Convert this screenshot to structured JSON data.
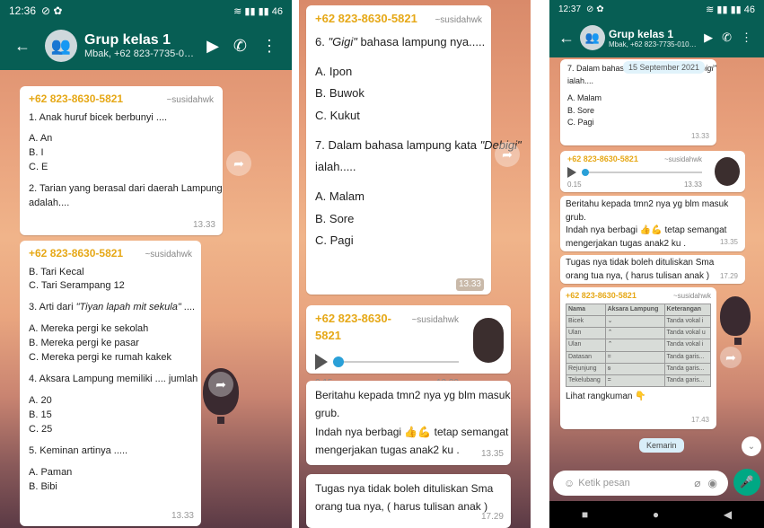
{
  "p1": {
    "status": {
      "time": "12:36",
      "icons_left": "⊘ ✿",
      "icons_right": "≋ ▮▮ ▮▮ 46"
    },
    "chat": {
      "title": "Grup kelas 1",
      "subtitle": "Mbak, +62 823-7735-0107, +6..."
    },
    "msg1": {
      "sender": "+62 823-8630-5821",
      "alias": "~susidahwk",
      "lines": [
        "1. Anak huruf bicek berbunyi ....",
        "",
        "A. An",
        "B. I",
        "C. E",
        "",
        "2. Tarian yang berasal dari daerah Lampung",
        "adalah...."
      ],
      "time": "13.33"
    },
    "msg2": {
      "sender": "+62 823-8630-5821",
      "alias": "~susidahwk",
      "lines": [
        "B. Tari Kecal",
        "C. Tari Serampang 12",
        "",
        "3. Arti dari",
        "",
        "A. Mereka pergi ke sekolah",
        "B. Mereka pergi ke pasar",
        "C. Mereka pergi ke rumah kakek",
        "",
        "4. Aksara Lampung memiliki .... jumlah",
        "",
        "A. 20",
        "B. 15",
        "C. 25",
        "",
        "5. Keminan artinya .....",
        "",
        "A. Paman",
        "B. Bibi"
      ],
      "q3_italic": "\"Tiyan lapah mit sekula\"",
      "q3_suffix": " ....",
      "time": "13.33"
    }
  },
  "p2": {
    "msg1": {
      "sender": "+62 823-8630-5821",
      "alias": "~susidahwk",
      "q6_prefix": "6. ",
      "q6_italic": "\"Gigi\"",
      "q6_suffix": " bahasa lampung nya.....",
      "opts6": [
        "A. Ipon",
        "B. Buwok",
        "C. Kukut"
      ],
      "q7_prefix": "7. Dalam bahasa lampung kata ",
      "q7_italic": "\"Debigi\"",
      "q7_line2": "ialah.....",
      "opts7": [
        "A. Malam",
        "B. Sore",
        "C. Pagi"
      ],
      "time": "13.33"
    },
    "voice": {
      "sender": "+62 823-8630-5821",
      "alias": "~susidahwk",
      "duration": "0.15",
      "time": "13.33"
    },
    "msg3": {
      "lines": [
        "Beritahu kepada tmn2 nya yg blm masuk",
        "grub.",
        "Indah nya berbagi 👍💪 tetap semangat",
        "mengerjakan tugas anak2 ku ."
      ],
      "time": "13.35"
    },
    "msg4": {
      "lines": [
        "Tugas nya tidak boleh dituliskan Sma",
        "orang tua nya, ( harus tulisan anak )"
      ],
      "time": "17.29"
    }
  },
  "p3": {
    "status": {
      "time": "12:37",
      "icons_left": "⊘ ✿",
      "icons_right": "≋ ▮▮ ▮▮ 46"
    },
    "chat": {
      "title": "Grup kelas 1",
      "subtitle": "Mbak, +62 823-7735-0107, +6..."
    },
    "datechip": "15 September 2021",
    "msg1": {
      "line1": "7. Dalam bahas",
      "line1_tail": "ebigi\"",
      "lines": [
        "ialah....",
        "",
        "A. Malam",
        "B. Sore",
        "C. Pagi"
      ],
      "time": "13.33"
    },
    "voice": {
      "sender": "+62 823-8630-5821",
      "alias": "~susidahwk",
      "duration": "0.15",
      "time": "13.33"
    },
    "msg3": {
      "lines": [
        "Beritahu kepada tmn2 nya yg blm masuk",
        "grub.",
        "Indah nya berbagi 👍💪 tetap semangat",
        "mengerjakan tugas anak2 ku ."
      ],
      "time": "13.35"
    },
    "msg4": {
      "lines": [
        "Tugas nya tidak boleh dituliskan Sma",
        "orang tua nya, ( harus tulisan anak )"
      ],
      "time": "17.29"
    },
    "msg5": {
      "sender": "+62 823-8630-5821",
      "alias": "~susidahwk",
      "table_headers": [
        "Nama",
        "Aksara Lampung",
        "Keterangan"
      ],
      "table_rows": [
        [
          "Bicek",
          "⌄",
          "Tanda vokal i"
        ],
        [
          "Ulan",
          "⌃",
          "Tanda vokal u"
        ],
        [
          "Ulan",
          "⌃",
          "Tanda vokal i"
        ],
        [
          "Datasan",
          "=",
          "Tanda garis..."
        ],
        [
          "Rejunjung",
          "ꞩ",
          "Tanda garis..."
        ],
        [
          "Tekelubang",
          "=",
          "Tanda garis..."
        ]
      ],
      "caption": "Lihat rangkuman 👇",
      "time": "17.43"
    },
    "kemarin": "Kemarin",
    "input_placeholder": "Ketik pesan"
  }
}
